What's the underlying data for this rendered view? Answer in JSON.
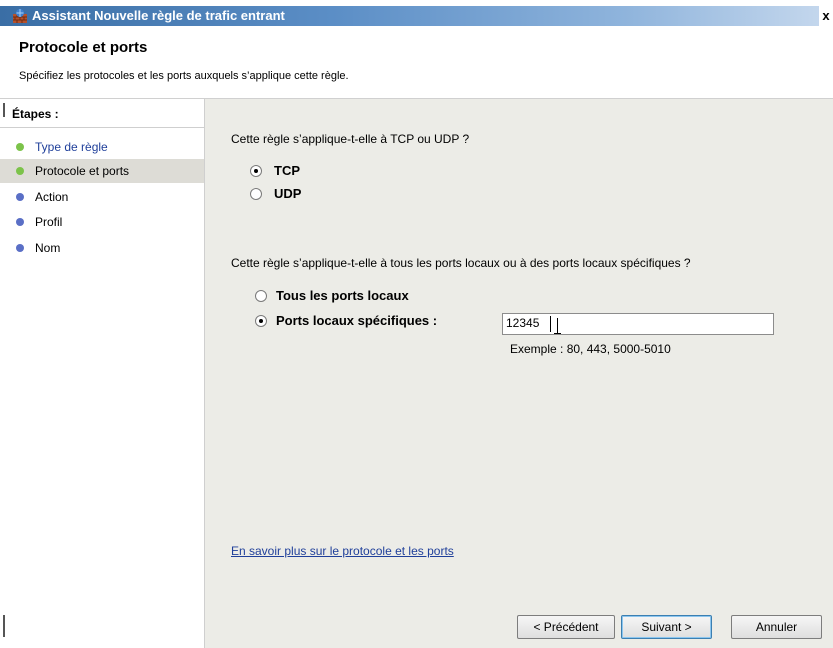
{
  "window": {
    "title": "Assistant Nouvelle règle de trafic entrant",
    "close_glyph": "x",
    "icon": "firewall-icon"
  },
  "header": {
    "title": "Protocole et ports",
    "description": "Spécifiez les protocoles et les ports auxquels s’applique cette règle."
  },
  "sidebar": {
    "title": "Étapes :",
    "steps": [
      {
        "label": "Type de règle",
        "dot_color": "#7cc34a",
        "state": "done"
      },
      {
        "label": "Protocole et ports",
        "dot_color": "#7cc34a",
        "state": "current"
      },
      {
        "label": "Action",
        "dot_color": "#5a6fc6",
        "state": "pending"
      },
      {
        "label": "Profil",
        "dot_color": "#5a6fc6",
        "state": "pending"
      },
      {
        "label": "Nom",
        "dot_color": "#5a6fc6",
        "state": "pending"
      }
    ]
  },
  "main": {
    "protocol_question": "Cette règle s’applique-t-elle à TCP ou UDP ?",
    "protocol_options": [
      {
        "label": "TCP",
        "selected": true
      },
      {
        "label": "UDP",
        "selected": false
      }
    ],
    "ports_question": "Cette règle s’applique-t-elle à tous les ports locaux ou à des ports locaux spécifiques ?",
    "port_options": [
      {
        "label": "Tous les ports locaux",
        "selected": false
      },
      {
        "label": "Ports locaux spécifiques :",
        "selected": true
      }
    ],
    "port_value": "12345",
    "example": "Exemple : 80, 443, 5000-5010",
    "learn_more": "En savoir plus sur le protocole et les ports"
  },
  "buttons": {
    "previous": "< Précédent",
    "next": "Suivant >",
    "cancel": "Annuler"
  },
  "colors": {
    "titlebar": "#3a6ea5",
    "content_bg": "#ecece7",
    "link": "#1f3f9a",
    "active_step_bg": "#dddcd6"
  }
}
